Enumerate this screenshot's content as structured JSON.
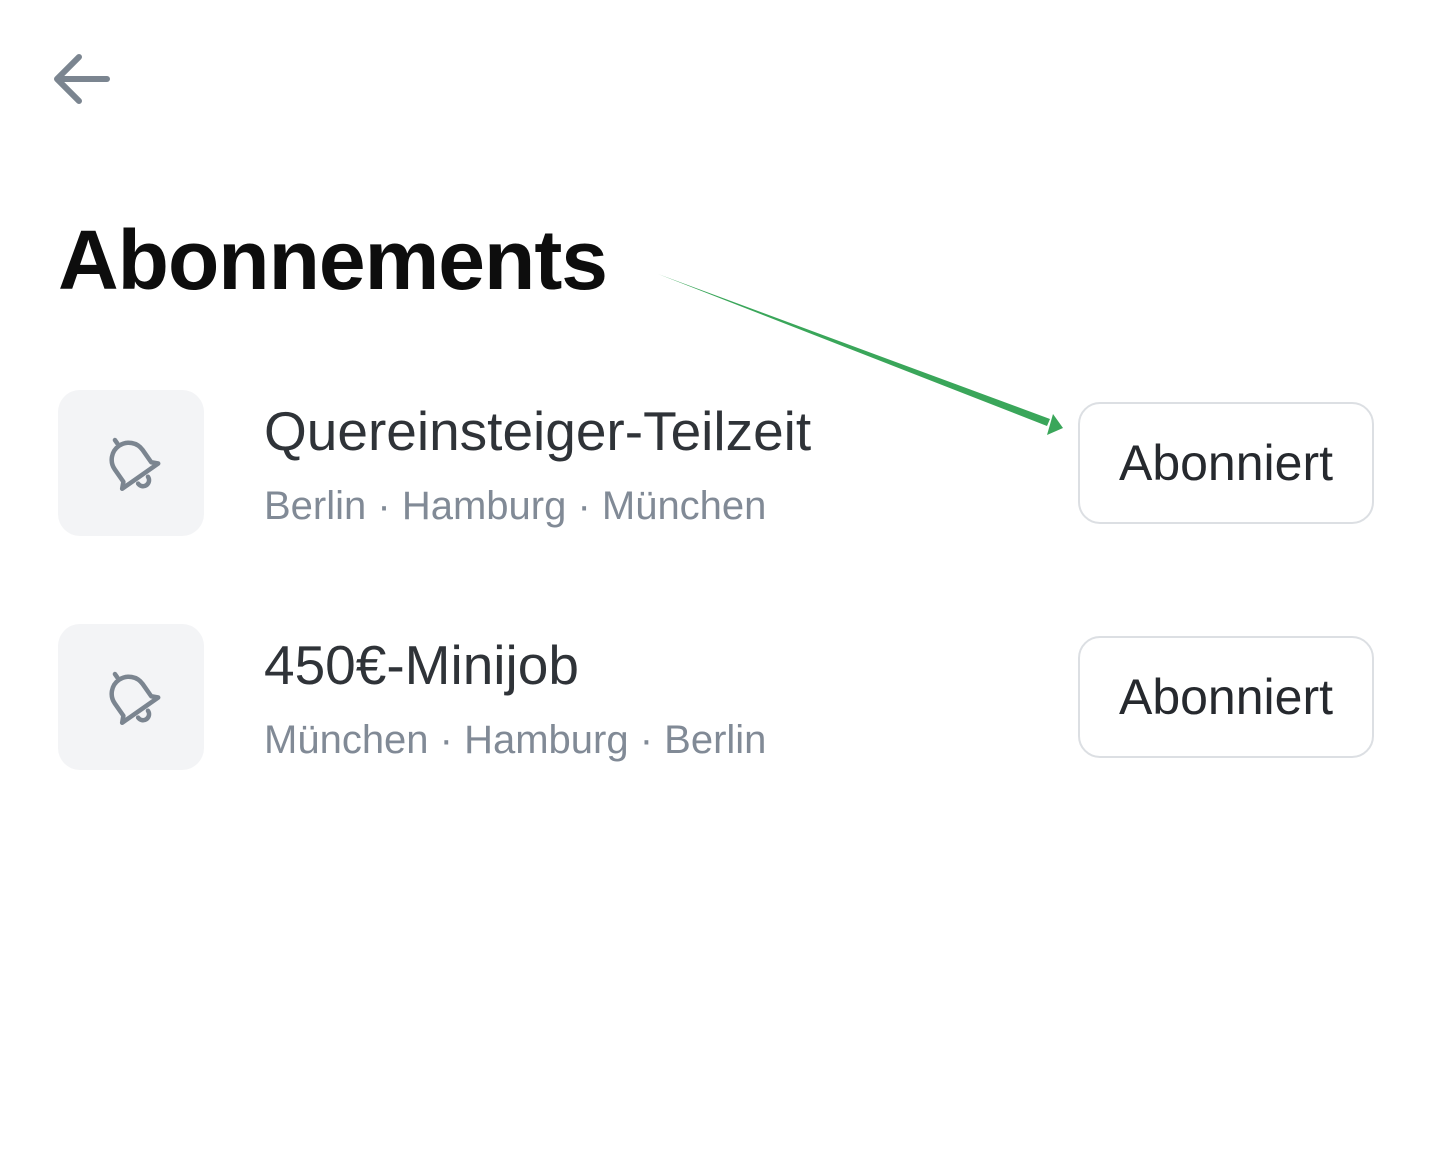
{
  "header": {
    "back_icon": "arrow-left-icon",
    "title": "Abonnements"
  },
  "subscriptions": [
    {
      "name": "Quereinsteiger-Teilzeit",
      "cities": "Berlin · Hamburg · München",
      "icon": "bell-icon",
      "button_label": "Abonniert"
    },
    {
      "name": "450€-Minijob",
      "cities": "München · Hamburg · Berlin",
      "icon": "bell-icon",
      "button_label": "Abonniert"
    }
  ],
  "colors": {
    "title": "#0d0d0d",
    "icon": "#7b8590",
    "secondary_text": "#818a96",
    "tile_background": "#f3f4f6",
    "annotation_arrow": "#3aa65a"
  }
}
